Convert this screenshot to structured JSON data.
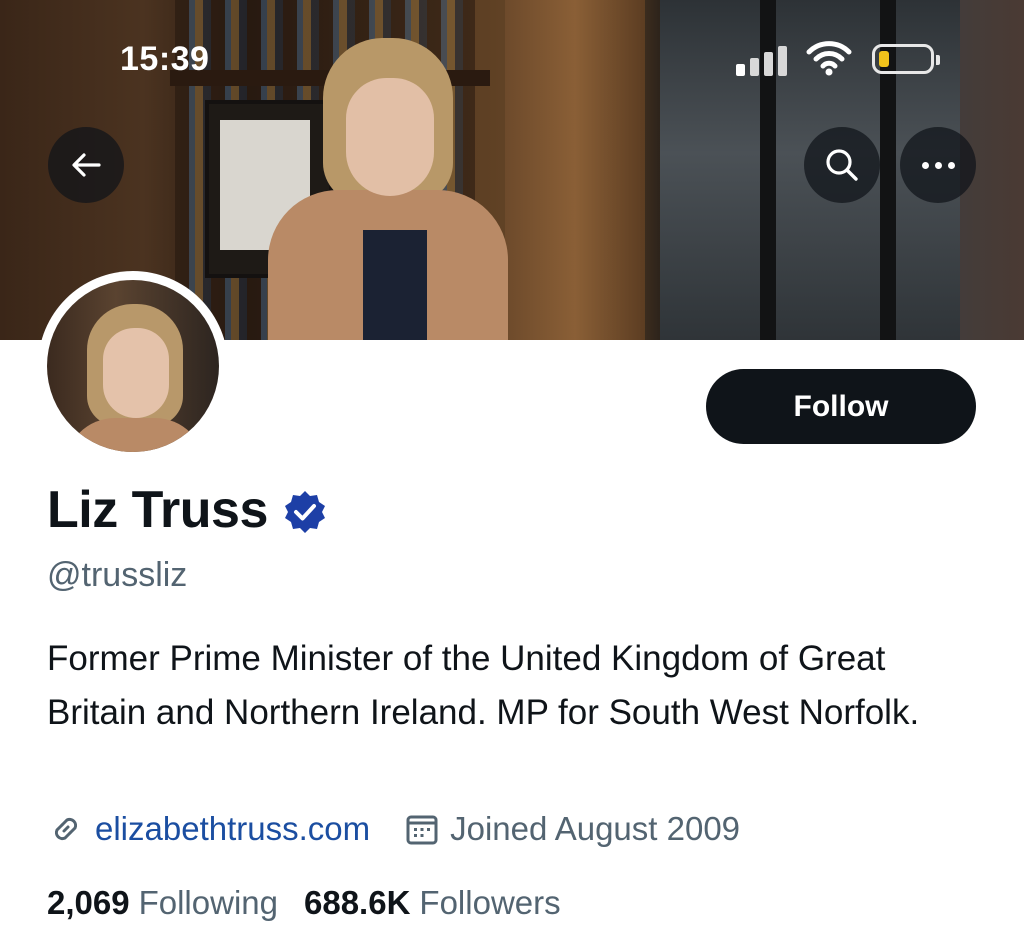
{
  "status_bar": {
    "time": "15:39"
  },
  "header": {
    "back_icon": "arrow-left-icon",
    "search_icon": "search-icon",
    "more_icon": "more-horizontal-icon"
  },
  "profile": {
    "display_name": "Liz Truss",
    "verified_icon": "verified-badge-icon",
    "handle": "@trussliz",
    "follow_label": "Follow",
    "bio": "Former Prime Minister of the United Kingdom of Great Britain and Northern Ireland. MP for South West Norfolk.",
    "website": "elizabethtruss.com",
    "joined": "Joined August 2009",
    "following_count": "2,069",
    "following_label": "Following",
    "followers_count": "688.6K",
    "followers_label": "Followers"
  },
  "colors": {
    "accent_link": "#1b4ea1",
    "verified_blue": "#1d3fa6",
    "button_dark": "#0f1419",
    "secondary_text": "#536471",
    "battery_level": "#f1c21b"
  },
  "battery_level_fraction": 0.2
}
